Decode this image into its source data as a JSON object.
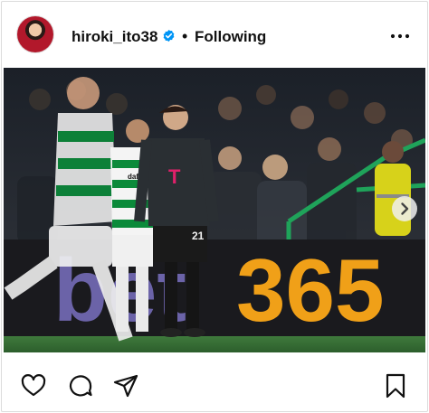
{
  "post": {
    "username": "hiroki_ito38",
    "follow_status": "Following",
    "separator": "•",
    "verified": true,
    "image": {
      "ad_board_text_left": "bet",
      "ad_board_text_right": "365",
      "jersey_number": "21",
      "sponsor_mark": "T",
      "shirt_text": "dafa"
    }
  },
  "icons": {
    "verified": "verified-badge-icon",
    "more": "more-options-icon",
    "next": "chevron-right-icon",
    "like": "heart-icon",
    "comment": "comment-icon",
    "share": "send-icon",
    "save": "bookmark-icon"
  },
  "colors": {
    "verified_blue": "#0095f6",
    "text": "#111111",
    "border": "#dbdbdb",
    "bayern_kit": "#2a2f33",
    "celtic_green": "#0b8a3a",
    "ad_orange": "#f0a018",
    "ad_purple": "#6b63a8"
  }
}
